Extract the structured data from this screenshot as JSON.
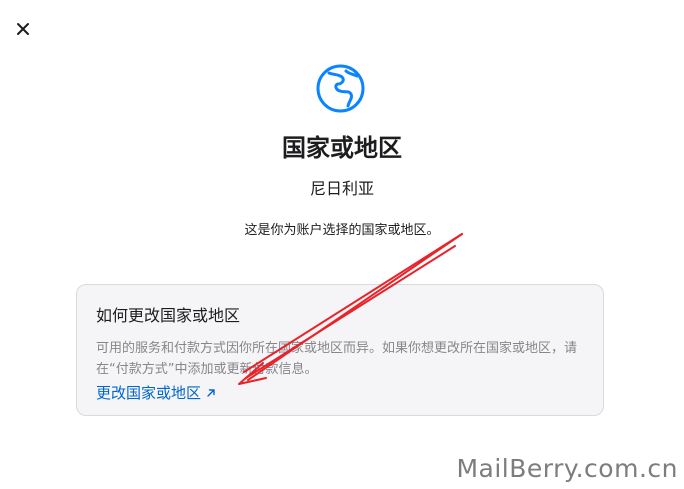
{
  "dialog": {
    "close_icon": "close-icon",
    "globe_icon": "globe-icon",
    "title": "国家或地区",
    "country": "尼日利亚",
    "description": "这是你为账户选择的国家或地区。",
    "accent_color": "#0a84ff"
  },
  "card": {
    "title": "如何更改国家或地区",
    "body": "可用的服务和付款方式因你所在国家或地区而异。如果你想更改所在国家或地区，请在“付款方式”中添加或更新付款信息。",
    "link_label": "更改国家或地区",
    "link_icon": "external-arrow-icon",
    "link_color": "#0066cc"
  },
  "annotation": {
    "arrow_color": "#e8242b"
  },
  "watermark": "MailBerry.com.cn"
}
